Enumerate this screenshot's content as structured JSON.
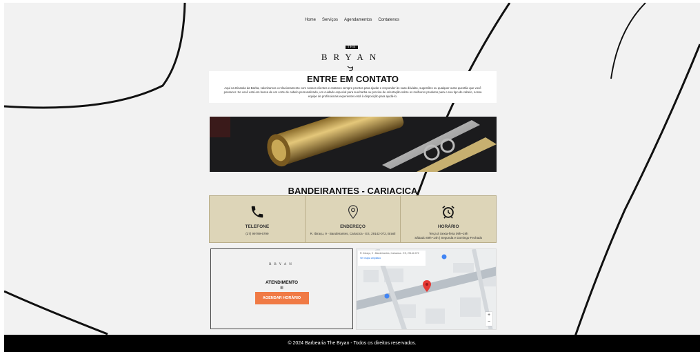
{
  "nav": {
    "items": [
      "Home",
      "Serviços",
      "Agendamentos",
      "Contatenos"
    ]
  },
  "logo": {
    "the": "THE",
    "name": "BRYAN"
  },
  "contact": {
    "title": "ENTRE EM CONTATO",
    "text": "Aqui na Dinastia da Barba, valorizamos o relacionamento com nossos clientes e estamos sempre prontos para ajudar e responder às suas dúvidas, sugestões ou qualquer outra questão que você possa ter. Se você está em busca de um corte de cabelo personalizado, um cuidado especial para sua barba ou precisa de orientação sobre os melhores produtos para o seu tipo de cabelo, nossa equipe de profissionais experientes está à disposição para ajudá-lo."
  },
  "location_title": "BANDEIRANTES - CARIACICA",
  "cards": [
    {
      "icon": "phone-icon",
      "title": "TELEFONE",
      "value": "(27) 99799-6799"
    },
    {
      "icon": "location-pin-icon",
      "title": "ENDEREÇO",
      "value": "R. Ibiraçu, 9 - Bandeirantes, Cariacica - ES, 29142-072, Brasil"
    },
    {
      "icon": "alarm-clock-icon",
      "title": "HORÁRIO",
      "value": "Terça à Sexta-feira 09h~19h",
      "value2": "Sábado 09h~14h | Segunda e Domingo Fechado"
    }
  ],
  "booking": {
    "mini_logo": "BRYAN",
    "label": "ATENDIMENTO",
    "button": "AGENDAR HORÁRIO"
  },
  "map": {
    "address_line": "R. Ibiraçu, 9 - Bandeirantes, Cariacica - ES, 29142-072",
    "enlarge": "Ampliar",
    "link": "Ver mapa ampliado",
    "street": "R. Ibiraçu",
    "place": "Casa Lunardi",
    "place2": "Loja de Ração",
    "zoom_in": "+",
    "zoom_out": "−"
  },
  "footer": "© 2024 Barbearia The Bryan - Todos os direitos reservados.",
  "colors": {
    "accent": "#f07a45",
    "card_bg": "#ddd5b8",
    "footer_bg": "#000000"
  }
}
